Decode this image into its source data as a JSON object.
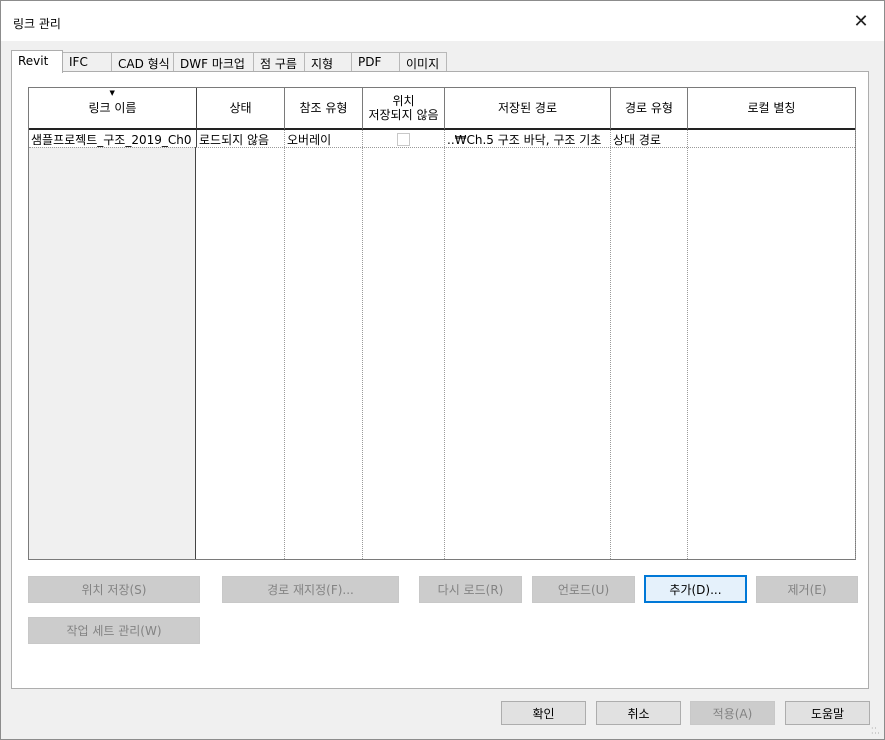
{
  "window": {
    "title": "링크 관리",
    "close_glyph": "✕"
  },
  "tabs": [
    {
      "label": "Revit",
      "active": true
    },
    {
      "label": "IFC"
    },
    {
      "label": "CAD 형식"
    },
    {
      "label": "DWF 마크업"
    },
    {
      "label": "점 구름"
    },
    {
      "label": "지형"
    },
    {
      "label": "PDF"
    },
    {
      "label": "이미지"
    }
  ],
  "table": {
    "columns": [
      {
        "label": "링크 이름",
        "sorted": true
      },
      {
        "label": "상태"
      },
      {
        "label": "참조 유형"
      },
      {
        "label_line1": "위치",
        "label_line2": "저장되지 않음"
      },
      {
        "label": "저장된 경로"
      },
      {
        "label": "경로 유형"
      },
      {
        "label": "로컬 별칭"
      }
    ],
    "sort_glyph": "▼",
    "rows": [
      {
        "name": "샘플프로젝트_구조_2019_Ch0",
        "status": "로드되지 않음",
        "ref_type": "오버레이",
        "unsaved_checked": false,
        "saved_path": "..₩Ch.5 구조 바닥, 구조 기초",
        "path_type": "상대 경로",
        "local_alias": ""
      }
    ]
  },
  "actions": {
    "save_location": "위치 저장(S)",
    "reload_from": "경로 재지정(F)...",
    "reload": "다시 로드(R)",
    "unload": "언로드(U)",
    "add": "추가(D)...",
    "remove": "제거(E)",
    "manage_worksets": "작업 세트 관리(W)"
  },
  "footer": {
    "ok": "확인",
    "cancel": "취소",
    "apply": "적용(A)",
    "help": "도움말"
  }
}
